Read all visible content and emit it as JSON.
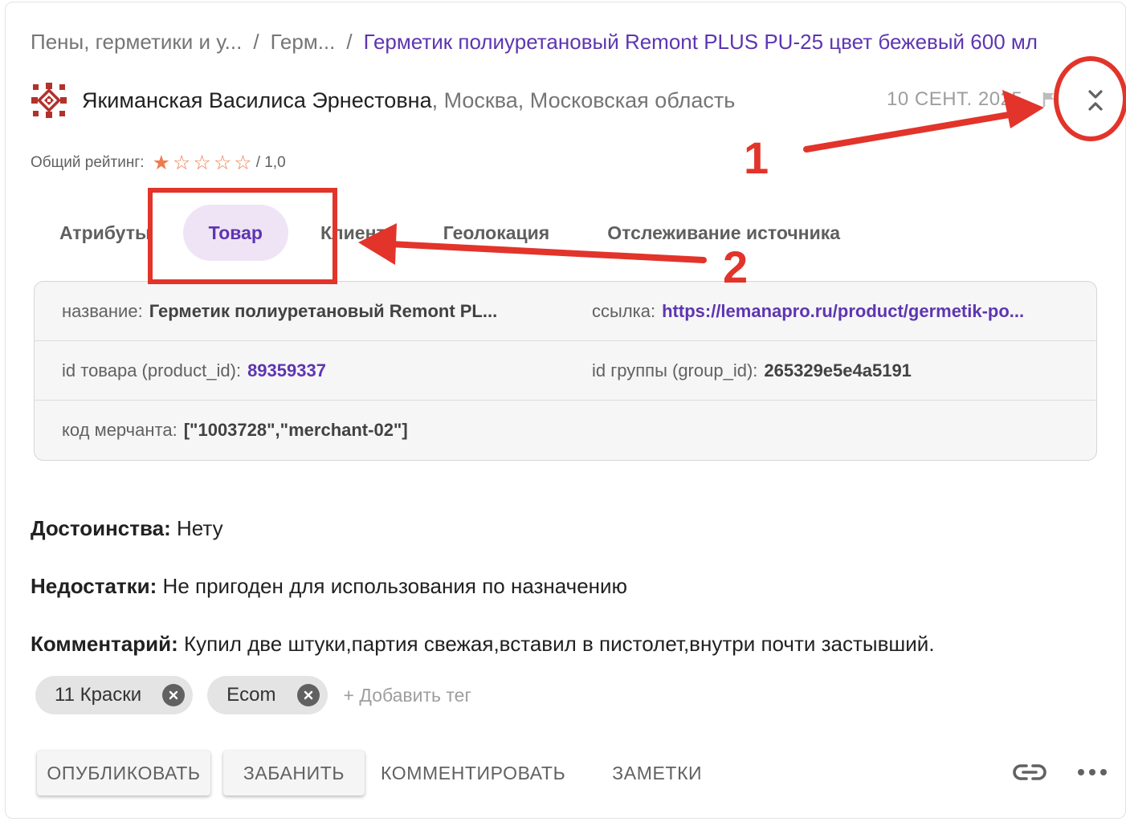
{
  "breadcrumb": {
    "items": [
      "Пены, герметики и у...",
      "Герм..."
    ],
    "separator": "/",
    "current": "Герметик полиуретановый Remont PLUS PU-25 цвет бежевый 600 мл"
  },
  "author": {
    "avatar_icon": "ornament-avatar-icon",
    "name": "Якиманская Василиса Эрнестовна",
    "location": ", Москва, Московская область",
    "date": "10 СЕНТ. 2025"
  },
  "rating": {
    "label": "Общий рейтинг:",
    "stars_filled": 1,
    "stars_total": 5,
    "value_text": "/ 1,0"
  },
  "tabs": [
    {
      "label": "Атрибуты",
      "active": false
    },
    {
      "label": "Товар",
      "active": true
    },
    {
      "label": "Клиент",
      "active": false
    },
    {
      "label": "Геолокация",
      "active": false
    },
    {
      "label": "Отслеживание источника",
      "active": false
    }
  ],
  "attributes": {
    "name_key": "название:",
    "name_val": "Герметик полиуретановый Remont PL...",
    "link_key": "ссылка:",
    "link_val": "https://lemanapro.ru/product/germetik-po...",
    "product_id_key": "id товара (product_id):",
    "product_id_val": "89359337",
    "group_id_key": "id группы (group_id):",
    "group_id_val": "265329e5e4a5191",
    "merchant_key": "код мерчанта:",
    "merchant_val": "[\"1003728\",\"merchant-02\"]"
  },
  "review": {
    "pros_label": "Достоинства:",
    "pros_text": " Нету",
    "cons_label": "Недостатки:",
    "cons_text": " Не пригоден для использования по назначению",
    "comment_label": "Комментарий:",
    "comment_text": " Купил две штуки,партия свежая,вставил в пистолет,внутри почти застывший."
  },
  "tags": {
    "items": [
      "11 Краски",
      "Ecom"
    ],
    "add_label": "+ Добавить тег"
  },
  "actions": {
    "publish": "ОПУБЛИКОВАТЬ",
    "ban": "ЗАБАНИТЬ",
    "comment": "КОММЕНТИРОВАТЬ",
    "notes": "ЗАМЕТКИ"
  },
  "annotations": {
    "step1": "1",
    "step2": "2",
    "color": "#e2342a"
  },
  "colors": {
    "accent": "#5e35b1",
    "active_tab_bg": "#efe4f5",
    "star": "#ef7b4b"
  }
}
